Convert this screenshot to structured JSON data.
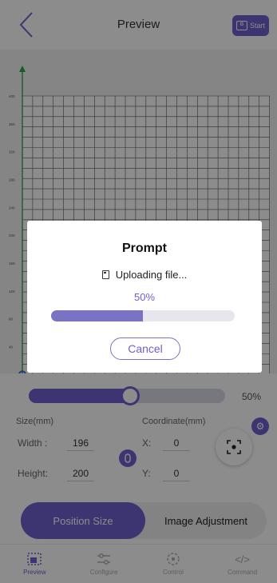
{
  "header": {
    "title": "Preview",
    "start_label": "Start",
    "start_icon": "gcode-icon"
  },
  "canvas": {
    "y_axis_ticks": [
      "400",
      "360",
      "320",
      "280",
      "240",
      "200",
      "160",
      "120",
      "80",
      "40",
      "0"
    ]
  },
  "size_slider": {
    "value_label": "50%",
    "fraction": 0.5
  },
  "size_section": {
    "label": "Size(mm)",
    "width_label": "Width :",
    "width_value": "196",
    "height_label": "Height:",
    "height_value": "200"
  },
  "coordinate_section": {
    "label": "Coordinate(mm)",
    "x_label": "X:",
    "x_value": "0",
    "y_label": "Y:",
    "y_value": "0"
  },
  "mode_tabs": [
    {
      "label": "Position Size",
      "active": true
    },
    {
      "label": "Image Adjustment",
      "active": false
    }
  ],
  "bottom_nav": [
    {
      "label": "Preview",
      "icon": "preview-icon",
      "active": true
    },
    {
      "label": "Configure",
      "icon": "configure-icon",
      "active": false
    },
    {
      "label": "Control",
      "icon": "control-icon",
      "active": false
    },
    {
      "label": "Command",
      "icon": "command-icon",
      "active": false
    }
  ],
  "dialog": {
    "title": "Prompt",
    "status": "Uploading file...",
    "percent_label": "50%",
    "progress_fraction": 0.5,
    "cancel_label": "Cancel"
  },
  "colors": {
    "accent": "#6f5fd0",
    "progress": "#7a73c4",
    "axis_y": "#2fa84f",
    "axis_x": "#e05050"
  }
}
